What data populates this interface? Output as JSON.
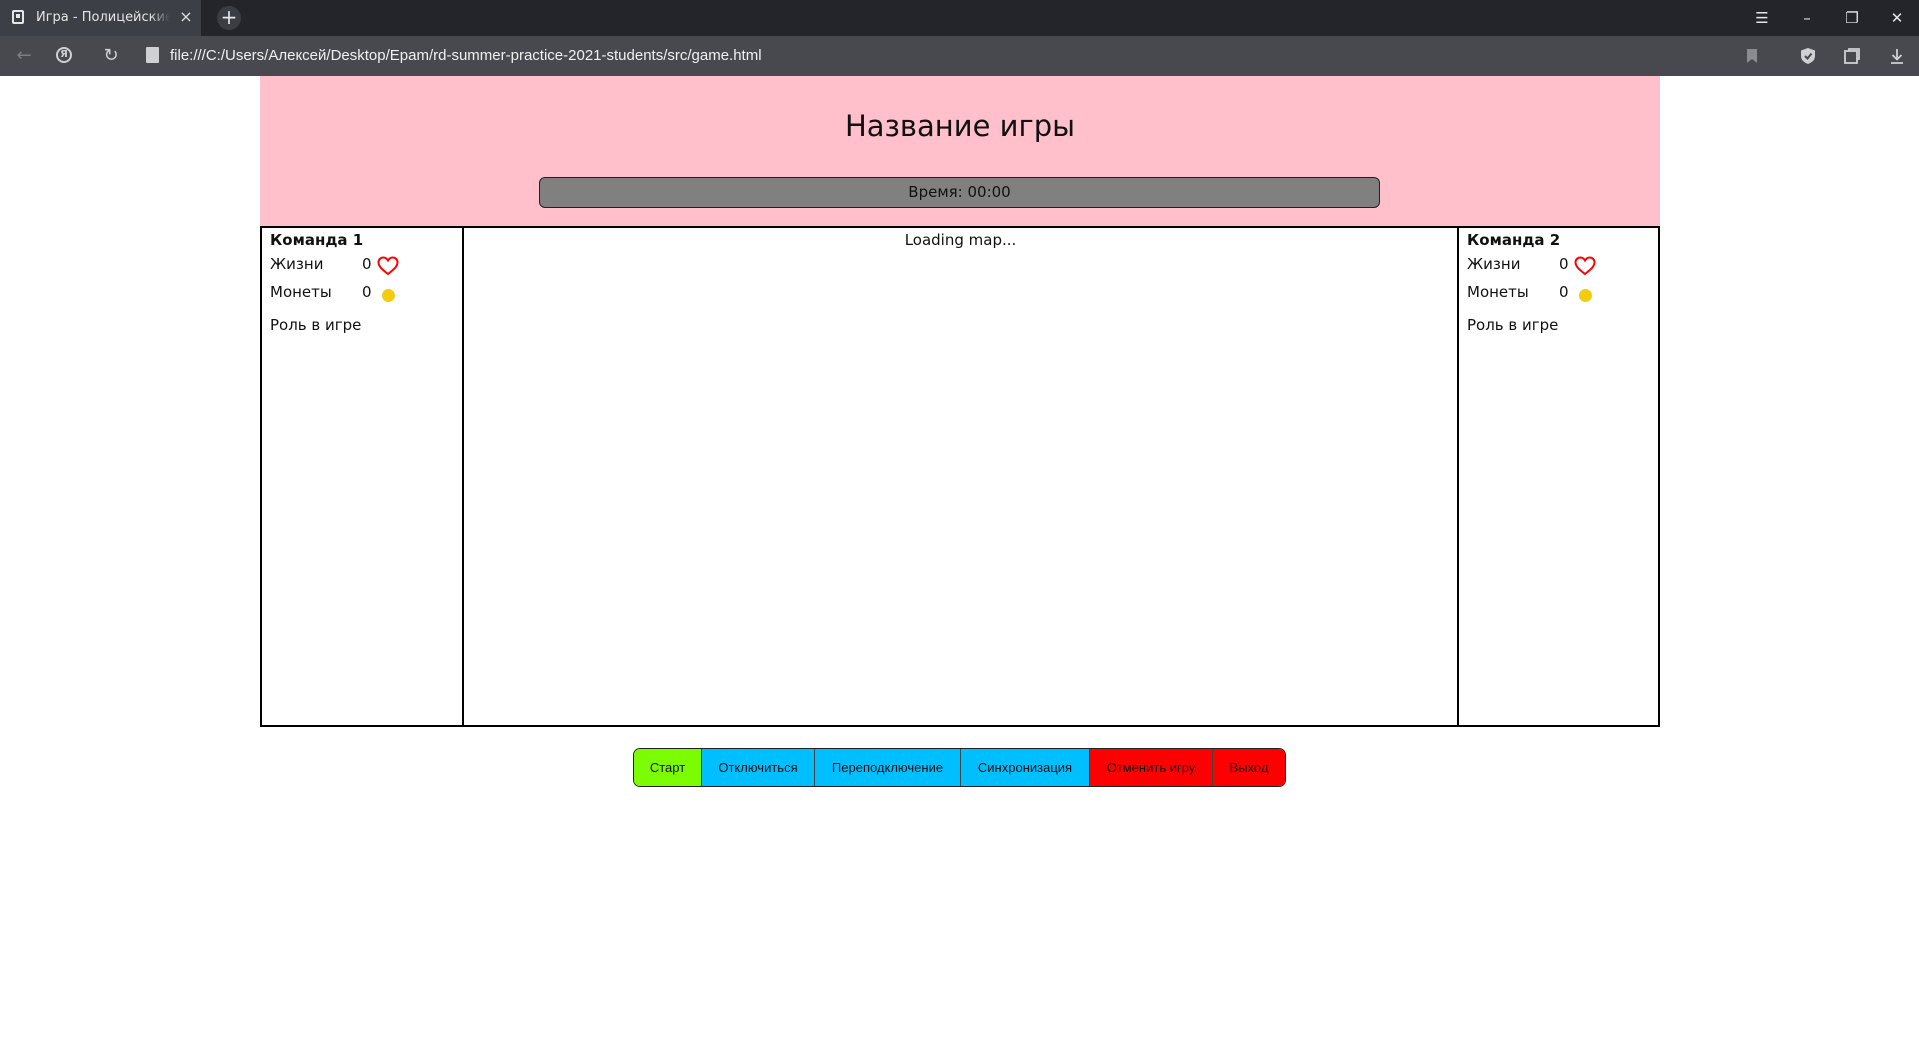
{
  "browser": {
    "tab_title": "Игра - Полицейские и воры",
    "url": "file:///C:/Users/Алексей/Desktop/Epam/rd-summer-practice-2021-students/src/game.html"
  },
  "page": {
    "title": "Название игры",
    "timer_label": "Время: 00:00",
    "map_status": "Loading map...",
    "team1": {
      "name": "Команда 1",
      "lives_label": "Жизни",
      "lives_value": "0",
      "coins_label": "Монеты",
      "coins_value": "0",
      "role_label": "Роль в игре"
    },
    "team2": {
      "name": "Команда 2",
      "lives_label": "Жизни",
      "lives_value": "0",
      "coins_label": "Монеты",
      "coins_value": "0",
      "role_label": "Роль в игре"
    },
    "controls": {
      "start": "Старт",
      "disconnect": "Отключиться",
      "reconnect": "Переподключение",
      "sync": "Синхронизация",
      "cancel": "Отменить игру",
      "exit": "Выход"
    }
  },
  "colors": {
    "header_bg": "#ffc0cb",
    "timer_bg": "#808080",
    "start_btn": "#7cfc00",
    "blue_btn": "#00bfff",
    "red_btn": "#ff0000",
    "heart": "#ff0000",
    "coin": "#f3cc12"
  },
  "icons": [
    "page-favicon-icon",
    "close-icon",
    "plus-icon",
    "menu-icon",
    "minimize-icon",
    "restore-icon",
    "close-window-icon",
    "back-icon",
    "yandex-icon",
    "reload-icon",
    "file-icon",
    "bookmark-icon",
    "shield-icon",
    "collections-icon",
    "download-icon",
    "heart-icon",
    "coin-icon"
  ]
}
